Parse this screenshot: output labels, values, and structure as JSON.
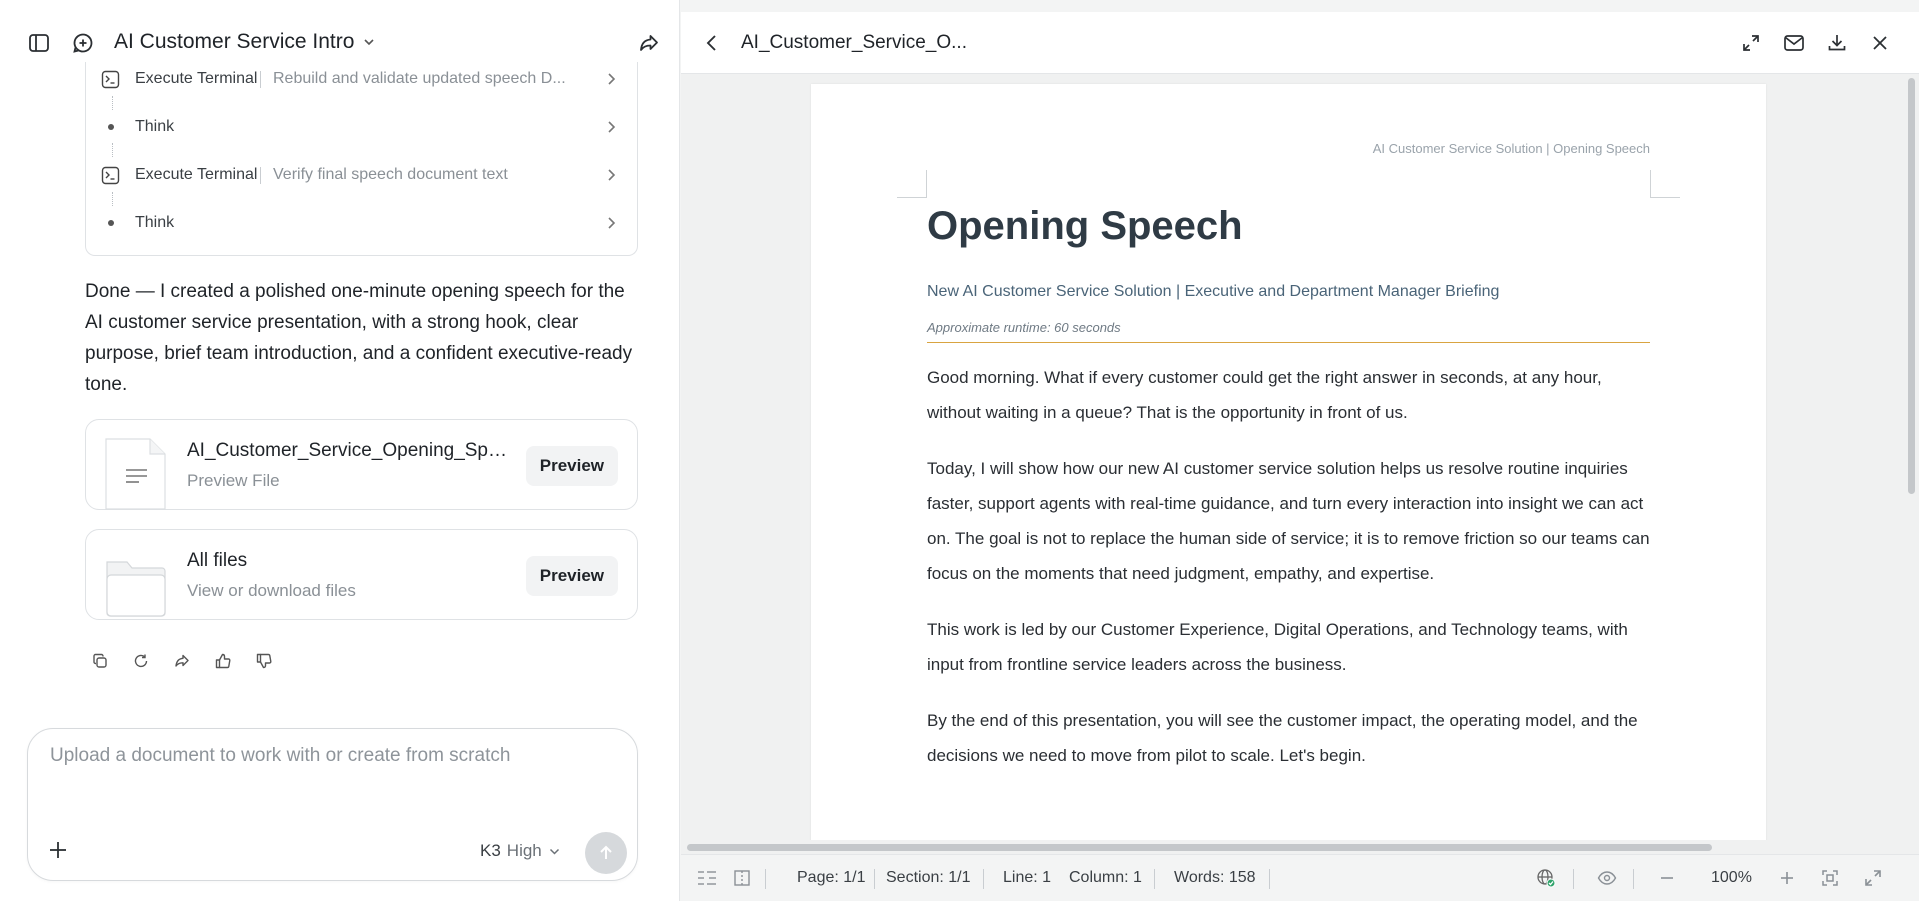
{
  "left": {
    "chat_title": "AI Customer Service Intro",
    "steps": [
      {
        "kind": "terminal",
        "name": "Execute Terminal",
        "desc": "Rebuild and validate updated speech D..."
      },
      {
        "kind": "think",
        "name": "Think",
        "desc": ""
      },
      {
        "kind": "terminal",
        "name": "Execute Terminal",
        "desc": "Verify final speech document text"
      },
      {
        "kind": "think",
        "name": "Think",
        "desc": ""
      }
    ],
    "reply": "Done — I created a polished one-minute opening speech for the AI customer service presentation, with a strong hook, clear purpose, brief team introduction, and a confident executive-ready tone.",
    "file_card": {
      "name": "AI_Customer_Service_Opening_Spee...",
      "sub": "Preview File",
      "button": "Preview"
    },
    "all_files_card": {
      "name": "All files",
      "sub": "View or download files",
      "button": "Preview"
    },
    "composer": {
      "placeholder": "Upload a document to work with or create from scratch",
      "model": "K3",
      "mode": "High"
    }
  },
  "doc": {
    "title": "AI_Customer_Service_O...",
    "running_header": "AI Customer Service Solution | Opening Speech",
    "heading": "Opening Speech",
    "subtitle": "New AI Customer Service Solution | Executive and Department Manager Briefing",
    "runtime": "Approximate runtime: 60 seconds",
    "paragraphs": [
      "Good morning. What if every customer could get the right answer in seconds, at any hour, without waiting in a queue? That is the opportunity in front of us.",
      "Today, I will show how our new AI customer service solution helps us resolve routine inquiries faster, support agents with real-time guidance, and turn every interaction into insight we can act on. The goal is not to replace the human side of service; it is to remove friction so our teams can focus on the moments that need judgment, empathy, and expertise.",
      "This work is led by our Customer Experience, Digital Operations, and Technology teams, with input from frontline service leaders across the business.",
      "By the end of this presentation, you will see the customer impact, the operating model, and the decisions we need to move from pilot to scale. Let's begin."
    ]
  },
  "status": {
    "page": "Page: 1/1",
    "section": "Section: 1/1",
    "line": "Line: 1",
    "column": "Column: 1",
    "words": "Words: 158",
    "zoom": "100%"
  },
  "colors": {
    "accent_rule": "#d9a441",
    "heading": "#2f3b45",
    "subtitle": "#4a6478"
  }
}
